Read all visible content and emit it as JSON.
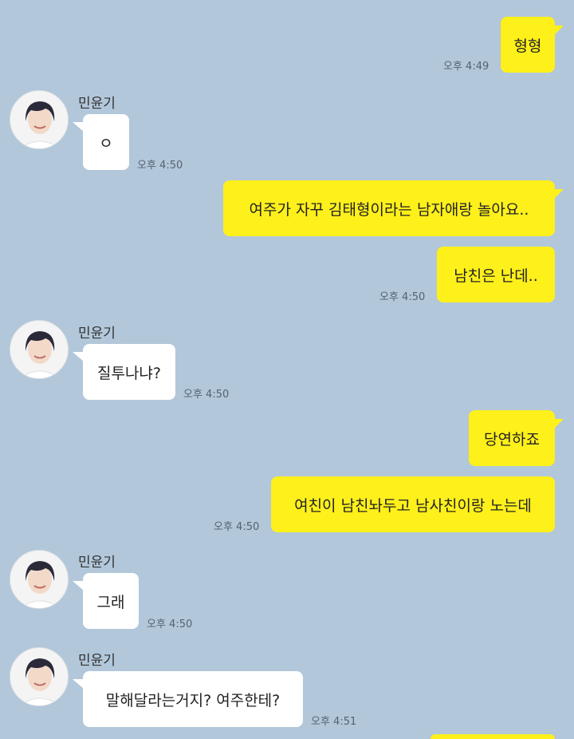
{
  "messages": [
    {
      "side": "me",
      "text": "형형",
      "time": "오후 4:49"
    },
    {
      "side": "them",
      "name": "민윤기",
      "text": "ㅇ",
      "time": "오후 4:50"
    },
    {
      "side": "me",
      "text": "여주가 자꾸 김태형이라는 남자애랑 놀아요..",
      "time": ""
    },
    {
      "side": "me",
      "text": "남친은 난데..",
      "time": "오후 4:50"
    },
    {
      "side": "them",
      "name": "민윤기",
      "text": "질투나냐?",
      "time": "오후 4:50"
    },
    {
      "side": "me",
      "text": "당연하죠",
      "time": ""
    },
    {
      "side": "me",
      "text": "여친이 남친놔두고 남사친이랑 노는데",
      "time": "오후 4:50"
    },
    {
      "side": "them",
      "name": "민윤기",
      "text": "그래",
      "time": "오후 4:50"
    },
    {
      "side": "them",
      "name": "민윤기",
      "text": "말해달라는거지? 여주한테?",
      "time": "오후 4:51"
    }
  ],
  "colors": {
    "background": "#b2c7da",
    "me_bubble": "#fef01b",
    "them_bubble": "#ffffff"
  }
}
